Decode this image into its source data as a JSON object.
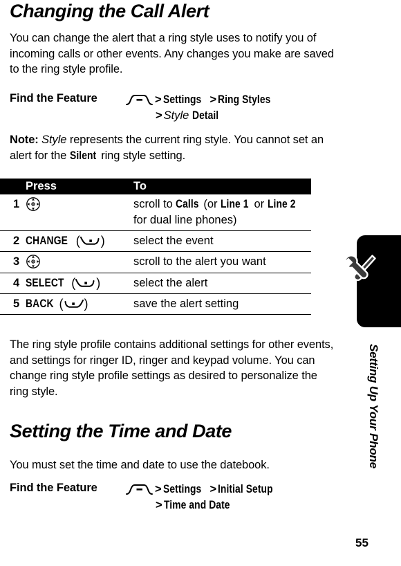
{
  "document": {
    "page_number": "55",
    "chapter_tab_label": "Setting Up Your Phone",
    "chapter_tab_icon": "wrench-screwdriver-icon"
  },
  "sections": [
    {
      "title": "Changing the Call Alert",
      "intro": "You can change the alert that a ring style uses to notify you of incoming calls or other events. Any changes you make are saved to the ring style profile."
    },
    {
      "title": "Setting the Time and Date",
      "intro": "You must set the time and date to use the datebook."
    }
  ],
  "find_the_feature_1": {
    "label": "Find the Feature",
    "menu_icon": "menu-key-icon",
    "line1_part1": "Settings",
    "line1_part2": "Ring Styles",
    "line2_italic": "Style",
    "line2_bold": "Detail",
    "separator": ">"
  },
  "find_the_feature_2": {
    "label": "Find the Feature",
    "menu_icon": "menu-key-icon",
    "line1_part1": "Settings",
    "line1_part2": "Initial Setup",
    "line2_bold": "Time and Date",
    "separator": ">"
  },
  "note": {
    "lead": "Note:",
    "italic_term": "Style",
    "text_a": "represents the current ring style. You cannot set an alert for the",
    "ui_term": "Silent",
    "text_b": "ring style setting."
  },
  "steps_table": {
    "headers": {
      "press": "Press",
      "to": "To"
    },
    "rows": [
      {
        "num": "1",
        "press_icon": "nav-key-icon",
        "press_label": "",
        "to_prefix": "scroll to",
        "to_ui_1": "Calls",
        "to_mid_1": "(or",
        "to_ui_2": "Line 1",
        "to_mid_2": "or",
        "to_ui_3": "Line 2",
        "to_suffix": "for dual line phones)"
      },
      {
        "num": "2",
        "press_icon": "right-soft-key-icon",
        "press_label": "CHANGE",
        "to_text": "select the event"
      },
      {
        "num": "3",
        "press_icon": "nav-key-icon",
        "press_label": "",
        "to_text": "scroll to the alert you want"
      },
      {
        "num": "4",
        "press_icon": "right-soft-key-icon",
        "press_label": "SELECT",
        "to_text": "select the alert"
      },
      {
        "num": "5",
        "press_icon": "left-soft-key-icon",
        "press_label": "BACK",
        "to_text": "save the alert setting"
      }
    ]
  },
  "closing_paragraph": "The ring style profile contains additional settings for other events, and settings for ringer ID, ringer and keypad volume. You can change ring style profile settings as desired to personalize the ring style."
}
